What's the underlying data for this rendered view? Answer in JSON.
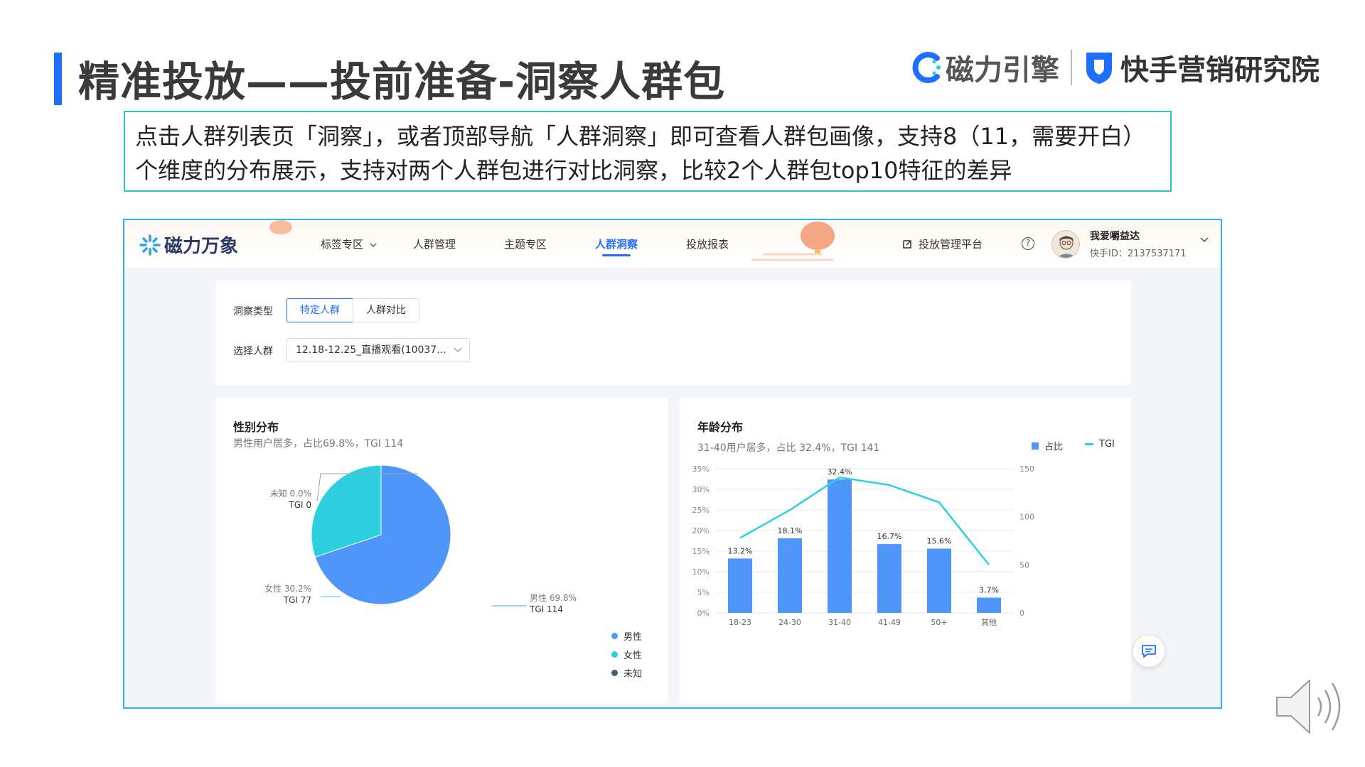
{
  "slide": {
    "title": "精准投放——投前准备-洞察人群包",
    "logo_left": "磁力引擎",
    "logo_right": "快手营销研究院",
    "desc_line1": "点击人群列表页「洞察」，或者顶部导航「人群洞察」即可查看人群包画像，支持8（11，需要开白）",
    "desc_line2": "个维度的分布展示，支持对两个人群包进行对比洞察，比较2个人群包top10特征的差异"
  },
  "app": {
    "logo": "磁力万象",
    "nav": [
      {
        "label": "标签专区"
      },
      {
        "label": "人群管理"
      },
      {
        "label": "主题专区"
      },
      {
        "label": "人群洞察"
      },
      {
        "label": "投放报表"
      }
    ],
    "ext_link": "投放管理平台",
    "help": "?",
    "user": {
      "name": "我爱嚼益达",
      "id": "快手ID：2137537171"
    }
  },
  "filters": {
    "type_label": "洞察类型",
    "type_options": [
      "特定人群",
      "人群对比"
    ],
    "selected_type": "特定人群",
    "audience_label": "选择人群",
    "audience_value": "12.18-12.25_直播观看(10037..."
  },
  "gender": {
    "title": "性别分布",
    "summary": "男性用户居多，占比69.8%，TGI 114",
    "labels": {
      "unknown": "未知 0.0%",
      "unknown_tgi": "TGI 0",
      "female": "女性 30.2%",
      "female_tgi": "TGI 77",
      "male": "男性 69.8%",
      "male_tgi": "TGI 114"
    },
    "legend": [
      "男性",
      "女性",
      "未知"
    ]
  },
  "age": {
    "title": "年龄分布",
    "summary": "31-40用户居多，占比 32.4%，TGI 141",
    "legend": [
      "占比",
      "TGI"
    ]
  },
  "colors": {
    "male": "#4e96f9",
    "female": "#2ccfdf",
    "unknown": "#4a5a78",
    "accent": "#1e6fff",
    "frame": "#2ab7e6"
  },
  "chart_data": [
    {
      "type": "pie",
      "categories": [
        "男性",
        "女性",
        "未知"
      ],
      "values": [
        69.8,
        30.2,
        0.0
      ],
      "tgi": [
        114,
        77,
        0
      ],
      "title": "性别分布",
      "legend": "bottom-right"
    },
    {
      "type": "bar",
      "title": "年龄分布",
      "categories": [
        "18-23",
        "24-30",
        "31-40",
        "41-49",
        "50+",
        "其他"
      ],
      "series": [
        {
          "name": "占比",
          "values": [
            13.2,
            18.1,
            32.4,
            16.7,
            15.6,
            3.7
          ]
        },
        {
          "name": "TGI",
          "type": "line",
          "values": [
            78,
            107,
            141,
            133,
            115,
            50
          ]
        }
      ],
      "data_labels": [
        "13.2%",
        "18.1%",
        "32.4%",
        "16.7%",
        "15.6%",
        "3.7%"
      ],
      "ylim": [
        0,
        35
      ],
      "y_ticks": [
        "0%",
        "5%",
        "10%",
        "15%",
        "20%",
        "25%",
        "30%",
        "35%"
      ],
      "y2lim": [
        0,
        150
      ],
      "y2_ticks": [
        "0",
        "50",
        "100",
        "150"
      ],
      "grid": true,
      "legend": "top-right"
    }
  ]
}
